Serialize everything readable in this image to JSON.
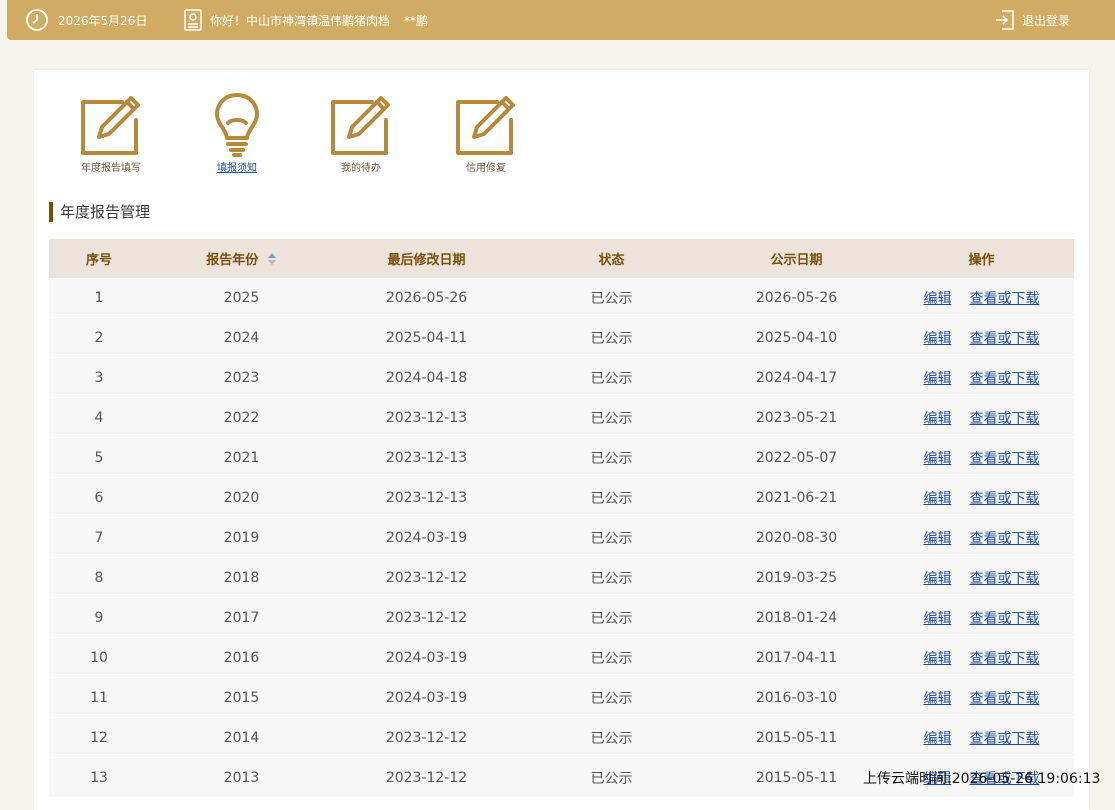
{
  "header": {
    "date": "2026年5月26日",
    "greeting": "你好！中山市神湾镇温伟鹏猪肉档",
    "user": "**鹏",
    "logout": "退出登录"
  },
  "nav": [
    {
      "label": "年度报告填写",
      "icon": "edit-icon"
    },
    {
      "label": "填报须知",
      "icon": "lightbulb-icon"
    },
    {
      "label": "我的待办",
      "icon": "edit-icon"
    },
    {
      "label": "信用修复",
      "icon": "edit-icon"
    }
  ],
  "section_title": "年度报告管理",
  "table": {
    "headers": [
      "序号",
      "报告年份",
      "最后修改日期",
      "状态",
      "公示日期",
      "操作"
    ],
    "actions": {
      "edit": "编辑",
      "view": "查看或下载"
    },
    "rows": [
      [
        "1",
        "2025",
        "2026-05-26",
        "已公示",
        "2026-05-26"
      ],
      [
        "2",
        "2024",
        "2025-04-11",
        "已公示",
        "2025-04-10"
      ],
      [
        "3",
        "2023",
        "2024-04-18",
        "已公示",
        "2024-04-17"
      ],
      [
        "4",
        "2022",
        "2023-12-13",
        "已公示",
        "2023-05-21"
      ],
      [
        "5",
        "2021",
        "2023-12-13",
        "已公示",
        "2022-05-07"
      ],
      [
        "6",
        "2020",
        "2023-12-13",
        "已公示",
        "2021-06-21"
      ],
      [
        "7",
        "2019",
        "2024-03-19",
        "已公示",
        "2020-08-30"
      ],
      [
        "8",
        "2018",
        "2023-12-12",
        "已公示",
        "2019-03-25"
      ],
      [
        "9",
        "2017",
        "2023-12-12",
        "已公示",
        "2018-01-24"
      ],
      [
        "10",
        "2016",
        "2024-03-19",
        "已公示",
        "2017-04-11"
      ],
      [
        "11",
        "2015",
        "2024-03-19",
        "已公示",
        "2016-03-10"
      ],
      [
        "12",
        "2014",
        "2023-12-12",
        "已公示",
        "2015-05-11"
      ],
      [
        "13",
        "2013",
        "2023-12-12",
        "已公示",
        "2015-05-11"
      ]
    ]
  },
  "watermark": "上传云端时间:2026-05-26 19:06:13",
  "colors": {
    "topbar": "#d1ab61",
    "accent": "#7a4f0b",
    "icon": "#b58a3c",
    "link": "#1f4d99"
  }
}
